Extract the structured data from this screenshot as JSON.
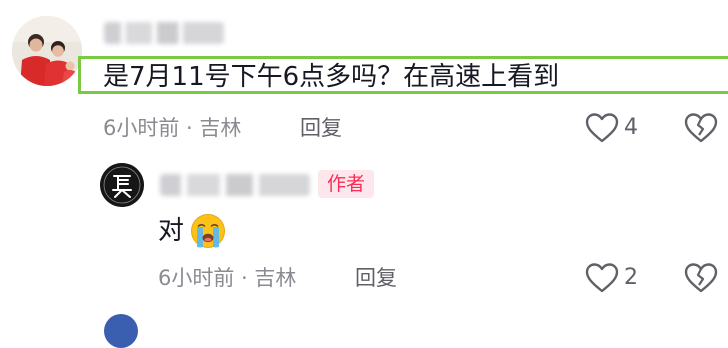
{
  "comment": {
    "text": "是7月11号下午6点多吗？在高速上看到",
    "meta": "6小时前 · 吉林",
    "reply_label": "回复",
    "like_count": "4"
  },
  "reply": {
    "author_badge": "作者",
    "text": "对",
    "emoji": "loudly-crying-face",
    "meta": "6小时前 · 吉林",
    "reply_label": "回复",
    "like_count": "2"
  },
  "colors": {
    "highlight_border": "#7ac943",
    "author_badge_text": "#fe2c55",
    "author_badge_bg": "#fde7ec",
    "meta_text": "#8a8b91"
  }
}
